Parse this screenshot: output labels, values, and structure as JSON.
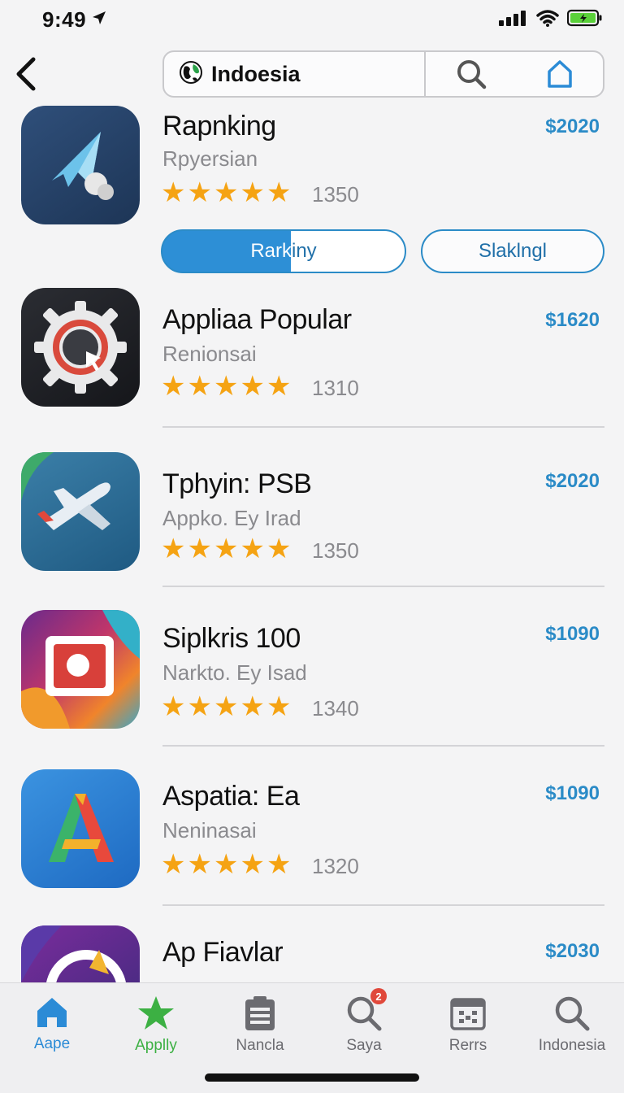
{
  "status_bar": {
    "time": "9:49"
  },
  "header": {
    "search_value": "Indoesia"
  },
  "action_buttons": {
    "primary_label": "Rarkiny",
    "secondary_label": "Slaklngl"
  },
  "apps": [
    {
      "title": "Rapnking",
      "subtitle": "Rpyersian",
      "rating_count": "1350",
      "price": "$2020",
      "rating": 5
    },
    {
      "title": "Appliaa Popular",
      "subtitle": "Renionsai",
      "rating_count": "1310",
      "price": "$1620",
      "rating": 5
    },
    {
      "title": "Tphyin: PSB",
      "subtitle": "Appko. Ey Irad",
      "rating_count": "1350",
      "price": "$2020",
      "rating": 5
    },
    {
      "title": "Siplkris  100",
      "subtitle": "Narkto. Ey Isad",
      "rating_count": "1340",
      "price": "$1090",
      "rating": 5
    },
    {
      "title": "Aspatia: Ea",
      "subtitle": "Neninasai",
      "rating_count": "1320",
      "price": "$1090",
      "rating": 5
    },
    {
      "title": "Ap Fiavlar",
      "subtitle": "",
      "rating_count": "",
      "price": "$2030",
      "rating": 0
    }
  ],
  "tabs": [
    {
      "label": "Aape",
      "icon": "home-icon",
      "color": "#2b8bd6"
    },
    {
      "label": "Applly",
      "icon": "star-icon",
      "color": "#3cb043"
    },
    {
      "label": "Nancla",
      "icon": "clipboard-icon",
      "color": "#6b6b70"
    },
    {
      "label": "Saya",
      "icon": "search-icon",
      "color": "#6b6b70",
      "badge": "2"
    },
    {
      "label": "Rerrs",
      "icon": "calendar-icon",
      "color": "#6b6b70"
    },
    {
      "label": "Indonesia",
      "icon": "search-icon",
      "color": "#6b6b70"
    }
  ],
  "colors": {
    "accent": "#2b8bc7",
    "star": "#f5a313",
    "badge": "#e0483b"
  }
}
